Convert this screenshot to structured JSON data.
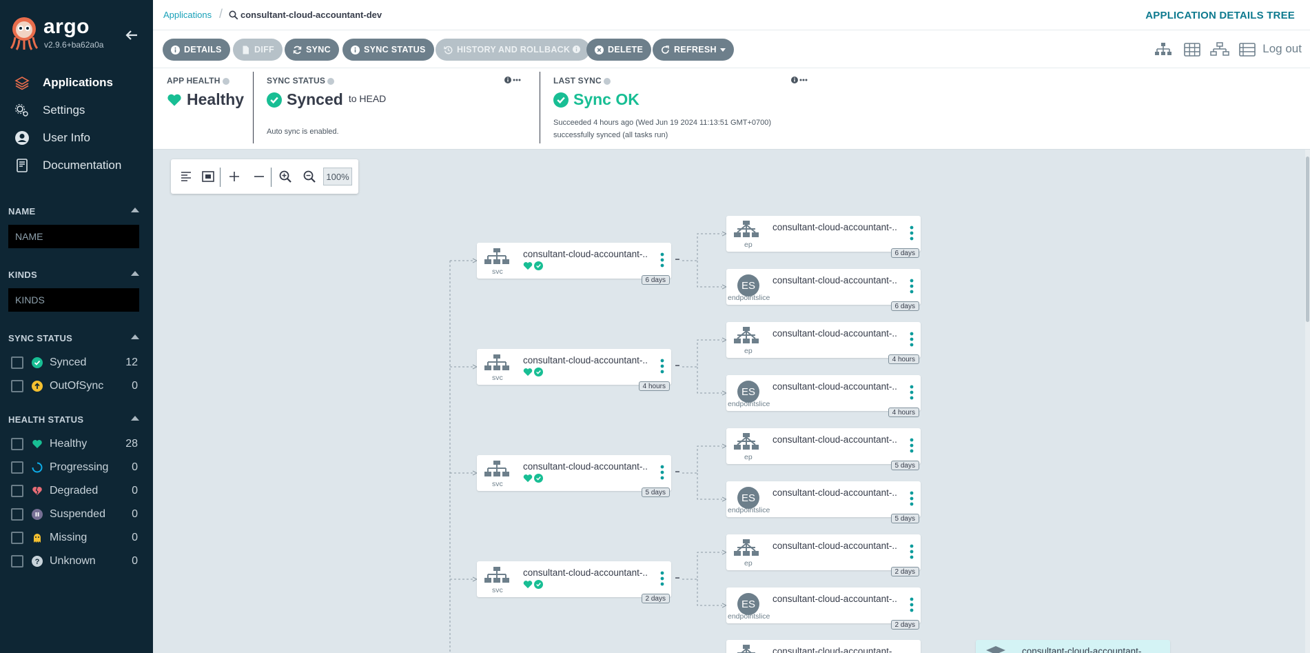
{
  "app": {
    "brand": "argo",
    "version": "v2.9.6+ba62a0a"
  },
  "nav": [
    {
      "label": "Applications",
      "icon": "layers-icon",
      "active": true
    },
    {
      "label": "Settings",
      "icon": "gears-icon",
      "active": false
    },
    {
      "label": "User Info",
      "icon": "user-circle-icon",
      "active": false
    },
    {
      "label": "Documentation",
      "icon": "book-icon",
      "active": false
    }
  ],
  "filters": {
    "name_label": "NAME",
    "name_placeholder": "NAME",
    "kinds_label": "KINDS",
    "kinds_placeholder": "KINDS",
    "sync_label": "SYNC STATUS",
    "sync_items": [
      {
        "label": "Synced",
        "count": "12",
        "icon": "check-circle-icon",
        "color": "#18be94"
      },
      {
        "label": "OutOfSync",
        "count": "0",
        "icon": "arrow-up-circle-icon",
        "color": "#f4c030"
      }
    ],
    "health_label": "HEALTH STATUS",
    "health_items": [
      {
        "label": "Healthy",
        "count": "28",
        "icon": "heart-icon",
        "color": "#18be94"
      },
      {
        "label": "Progressing",
        "count": "0",
        "icon": "spinner-icon",
        "color": "#0dadea"
      },
      {
        "label": "Degraded",
        "count": "0",
        "icon": "broken-heart-icon",
        "color": "#e96d76"
      },
      {
        "label": "Suspended",
        "count": "0",
        "icon": "pause-circle-icon",
        "color": "#766f94"
      },
      {
        "label": "Missing",
        "count": "0",
        "icon": "ghost-icon",
        "color": "#f4c030"
      },
      {
        "label": "Unknown",
        "count": "0",
        "icon": "question-circle-icon",
        "color": "#6d7f8b"
      }
    ]
  },
  "breadcrumb": {
    "root": "Applications",
    "current": "consultant-cloud-accountant-dev"
  },
  "page_title": "APPLICATION DETAILS TREE",
  "toolbar": {
    "details": "DETAILS",
    "diff": "DIFF",
    "sync": "SYNC",
    "sync_status": "SYNC STATUS",
    "history": "HISTORY AND ROLLBACK",
    "delete": "DELETE",
    "refresh": "REFRESH",
    "logout": "Log out"
  },
  "status": {
    "health_label": "APP HEALTH",
    "health_value": "Healthy",
    "sync_label": "SYNC STATUS",
    "sync_value": "Synced",
    "sync_target": "to HEAD",
    "sync_sub": "Auto sync is enabled.",
    "last_label": "LAST SYNC",
    "last_value": "Sync OK",
    "last_sub1": "Succeeded 4 hours ago (Wed Jun 19 2024 11:13:51 GMT+0700)",
    "last_sub2": "successfully synced (all tasks run)",
    "colors": {
      "healthy": "#18be94"
    }
  },
  "zoom": {
    "percent": "100%"
  },
  "tree": {
    "groups": [
      {
        "svc": {
          "name": "consultant-cloud-accountant-...",
          "kind": "svc",
          "age": "6 days"
        },
        "ep": {
          "name": "consultant-cloud-accountant-...",
          "kind": "ep",
          "age": "6 days"
        },
        "es": {
          "name": "consultant-cloud-accountant-...",
          "kind": "endpointslice",
          "badge": "ES",
          "age": "6 days"
        }
      },
      {
        "svc": {
          "name": "consultant-cloud-accountant-...",
          "kind": "svc",
          "age": "4 hours"
        },
        "ep": {
          "name": "consultant-cloud-accountant-...",
          "kind": "ep",
          "age": "4 hours"
        },
        "es": {
          "name": "consultant-cloud-accountant-...",
          "kind": "endpointslice",
          "badge": "ES",
          "age": "4 hours"
        }
      },
      {
        "svc": {
          "name": "consultant-cloud-accountant-...",
          "kind": "svc",
          "age": "5 days"
        },
        "ep": {
          "name": "consultant-cloud-accountant-...",
          "kind": "ep",
          "age": "5 days"
        },
        "es": {
          "name": "consultant-cloud-accountant-...",
          "kind": "endpointslice",
          "badge": "ES",
          "age": "5 days"
        }
      },
      {
        "svc": {
          "name": "consultant-cloud-accountant-...",
          "kind": "svc",
          "age": "2 days"
        },
        "ep": {
          "name": "consultant-cloud-accountant-...",
          "kind": "ep",
          "age": "2 days"
        },
        "es": {
          "name": "consultant-cloud-accountant-...",
          "kind": "endpointslice",
          "badge": "ES",
          "age": "2 days"
        }
      }
    ],
    "partial": [
      {
        "name": "consultant-cloud-accountant-..."
      },
      {
        "name": "consultant-cloud-accountant-..."
      }
    ]
  }
}
